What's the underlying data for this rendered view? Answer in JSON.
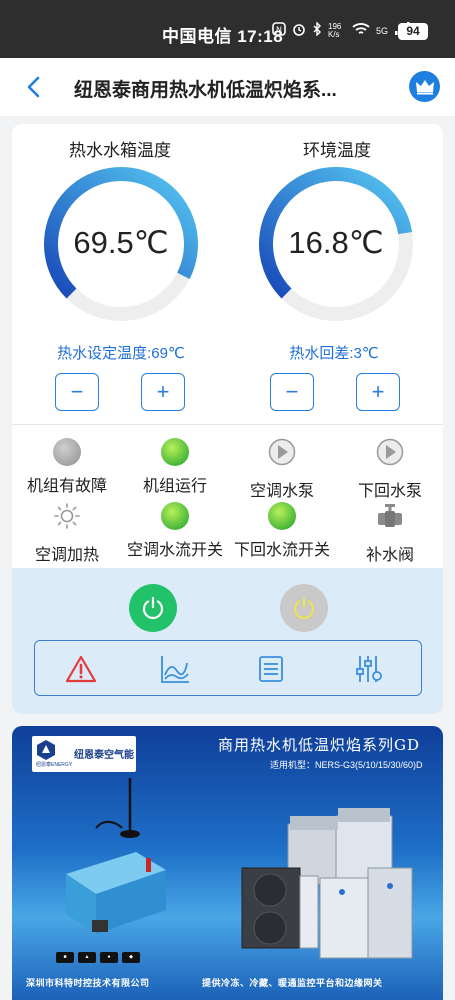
{
  "status_bar": {
    "carrier_time": "中国电信 17:18",
    "net_speed": "196 K/s",
    "network": "5G",
    "battery": "94"
  },
  "nav": {
    "title": "纽恩泰商用热水机低温炽焰系..."
  },
  "gauges": [
    {
      "title": "热水水箱温度",
      "value": "69.5℃",
      "setting": "热水设定温度:69℃",
      "fraction": 0.7
    },
    {
      "title": "环境温度",
      "value": "16.8℃",
      "setting": "热水回差:3℃",
      "fraction": 0.6
    }
  ],
  "stepper": {
    "minus": "−",
    "plus": "+"
  },
  "status_items": [
    {
      "label": "机组有故障",
      "icon": "gray-dot-icon"
    },
    {
      "label": "机组运行",
      "icon": "green-dot-icon"
    },
    {
      "label": "空调水泵",
      "icon": "pump-icon"
    },
    {
      "label": "下回水泵",
      "icon": "pump-icon"
    },
    {
      "label": "空调加热",
      "icon": "heater-sun-icon"
    },
    {
      "label": "空调水流开关",
      "icon": "green-dot-icon"
    },
    {
      "label": "下回水流开关",
      "icon": "green-dot-icon"
    },
    {
      "label": "补水阀",
      "icon": "valve-icon"
    }
  ],
  "controls": {
    "power_on_color": "#22c26a",
    "power_off_color": "#c9c9c9"
  },
  "toolbar": [
    "alarm-icon",
    "curve-chart-icon",
    "list-icon",
    "settings-sliders-icon"
  ],
  "banner": {
    "logo_text": "纽恩泰空气能",
    "logo_sub": "纽恩泰ENERGY",
    "headline": "商用热水机低温炽焰系列GD",
    "model": "适用机型：NERS-G3(5/10/15/30/60)D",
    "footer_left": "深圳市科特时控技术有限公司",
    "footer_right": "提供冷冻、冷藏、暖通监控平台和边缘网关"
  },
  "colors": {
    "accent": "#1f6fd6",
    "gauge_start": "#1848b8",
    "gauge_end": "#56c8f2",
    "gauge_track": "#eeeeee"
  }
}
